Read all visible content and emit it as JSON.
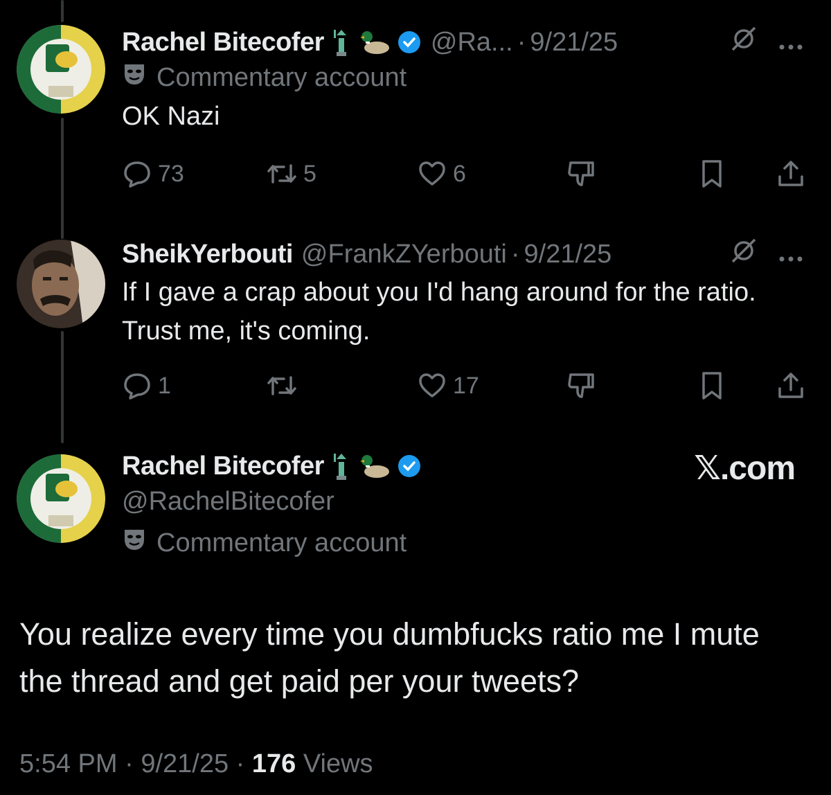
{
  "tweets": [
    {
      "name": "Rachel Bitecofer",
      "handle": "@Ra...",
      "date": "9/21/25",
      "label": "Commentary account",
      "text": "OK Nazi",
      "replies": "73",
      "reposts": "5",
      "likes": "6"
    },
    {
      "name": "SheikYerbouti",
      "handle": "@FrankZYerbouti",
      "date": "9/21/25",
      "text": "If I gave a crap about you I'd hang around for the ratio. Trust me, it's coming.",
      "replies": "1",
      "reposts": "",
      "likes": "17"
    }
  ],
  "main": {
    "name": "Rachel Bitecofer",
    "handle": "@RachelBitecofer",
    "label": "Commentary account",
    "watermark": "𝕏.com",
    "text": "You realize every time you dumbfucks ratio me I mute the thread and get paid per your tweets?",
    "time": "5:54 PM",
    "date": "9/21/25",
    "views_count": "176",
    "views_label": "Views"
  },
  "separator": "·",
  "colors": {
    "background": "#000000",
    "text": "#e7e9ea",
    "muted": "#71767b",
    "verified": "#1d9bf0"
  },
  "icons": [
    "statue-of-liberty-emoji",
    "duck-emoji",
    "verified-badge-icon",
    "grok-slash-icon",
    "more-icon",
    "reply-icon",
    "repost-icon",
    "like-icon",
    "dislike-icon",
    "bookmark-icon",
    "share-icon",
    "commentary-mask-icon"
  ]
}
